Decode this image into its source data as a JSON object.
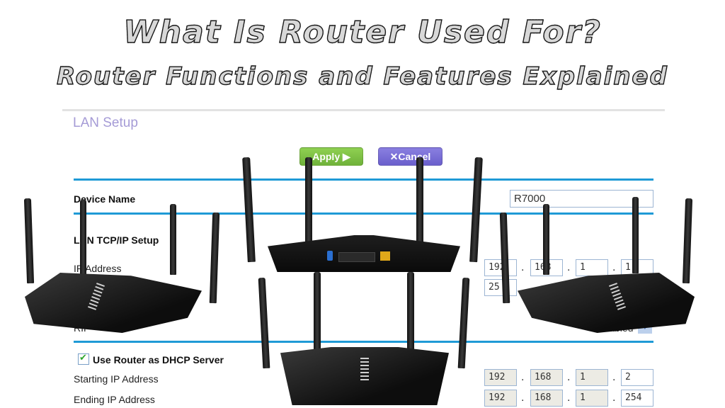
{
  "headline": {
    "title": "What Is Router Used For?",
    "subtitle": "Router Functions and Features Explained"
  },
  "panel": {
    "section_title": "LAN Setup",
    "apply_label": "Apply ▶",
    "cancel_label": "✕Cancel",
    "device_name_label": "Device Name",
    "device_name_value": "R7000",
    "tcpip_heading": "LAN TCP/IP Setup",
    "ip_address_label": "IP Address",
    "ip_address": [
      "192",
      "168",
      "1",
      "1"
    ],
    "subnet_visible": "25",
    "rip_label": "RIP",
    "rip_select_value": "Disabled",
    "dhcp_checkbox_label": "Use Router as DHCP Server",
    "dhcp_checked": true,
    "starting_ip_label": "Starting IP Address",
    "starting_ip": [
      "192",
      "168",
      "1",
      "2"
    ],
    "ending_ip_label": "Ending IP Address",
    "ending_ip": [
      "192",
      "168",
      "1",
      "254"
    ]
  },
  "colors": {
    "rule": "#1f9ad6",
    "apply": "#7bbf43",
    "cancel": "#7569d6",
    "section_title": "#a59bd6"
  },
  "routers": [
    {
      "view": "front-left-angle",
      "position_word": "left"
    },
    {
      "view": "rear-ports",
      "position_word": "top-center"
    },
    {
      "view": "front",
      "position_word": "bottom-center"
    },
    {
      "view": "front-right-angle",
      "position_word": "right"
    }
  ]
}
